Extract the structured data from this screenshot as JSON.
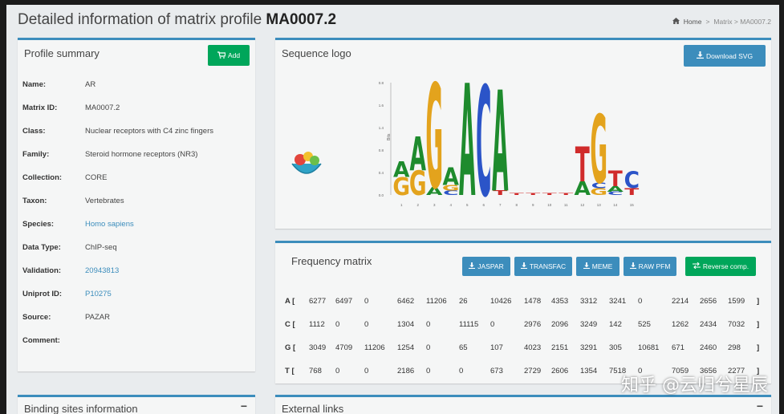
{
  "page": {
    "title_prefix": "Detailed information of matrix profile ",
    "title_id": "MA0007.2"
  },
  "breadcrumb": {
    "home": "Home",
    "sep": ">",
    "matrix": "Matrix > MA0007.2"
  },
  "summary": {
    "title": "Profile summary",
    "add_label": "Add",
    "fields": [
      {
        "k": "Name:",
        "v": "AR",
        "link": false
      },
      {
        "k": "Matrix ID:",
        "v": "MA0007.2",
        "link": false
      },
      {
        "k": "Class:",
        "v": "Nuclear receptors with C4 zinc fingers",
        "link": false
      },
      {
        "k": "Family:",
        "v": "Steroid hormone receptors (NR3)",
        "link": false
      },
      {
        "k": "Collection:",
        "v": "CORE",
        "link": false
      },
      {
        "k": "Taxon:",
        "v": "Vertebrates",
        "link": false
      },
      {
        "k": "Species:",
        "v": "Homo sapiens",
        "link": true
      },
      {
        "k": "Data Type:",
        "v": "ChIP-seq",
        "link": false
      },
      {
        "k": "Validation:",
        "v": "20943813",
        "link": true
      },
      {
        "k": "Uniprot ID:",
        "v": "P10275",
        "link": true
      },
      {
        "k": "Source:",
        "v": "PAZAR",
        "link": false
      },
      {
        "k": "Comment:",
        "v": "",
        "link": false
      }
    ]
  },
  "logo": {
    "title": "Sequence logo",
    "download_label": "Download SVG",
    "ylabel": "Bits",
    "yticks": [
      "0.8",
      "1.6",
      "1.4",
      "0.8",
      "0.4",
      "0.0"
    ],
    "positions": [
      "1",
      "2",
      "3",
      "4",
      "5",
      "6",
      "7",
      "8",
      "9",
      "10",
      "11",
      "12",
      "13",
      "14",
      "15"
    ],
    "stacks": [
      [
        {
          "b": "G",
          "h": 0.16
        },
        {
          "b": "A",
          "h": 0.14
        }
      ],
      [
        {
          "b": "G",
          "h": 0.22
        },
        {
          "b": "A",
          "h": 0.3
        }
      ],
      [
        {
          "b": "A",
          "h": 0.07
        },
        {
          "b": "G",
          "h": 0.93
        }
      ],
      [
        {
          "b": "C",
          "h": 0.04
        },
        {
          "b": "G",
          "h": 0.05
        },
        {
          "b": "A",
          "h": 0.16
        }
      ],
      [
        {
          "b": "A",
          "h": 1.0
        }
      ],
      [
        {
          "b": "C",
          "h": 0.98
        }
      ],
      [
        {
          "b": "T",
          "h": 0.04
        },
        {
          "b": "A",
          "h": 0.9
        }
      ],
      [
        {
          "b": "T",
          "h": 0.02
        }
      ],
      [
        {
          "b": "T",
          "h": 0.02
        }
      ],
      [
        {
          "b": "T",
          "h": 0.02
        }
      ],
      [
        {
          "b": "T",
          "h": 0.02
        }
      ],
      [
        {
          "b": "A",
          "h": 0.12
        },
        {
          "b": "T",
          "h": 0.31
        }
      ],
      [
        {
          "b": "G",
          "h": 0.06
        },
        {
          "b": "C",
          "h": 0.05
        },
        {
          "b": "G",
          "h": 0.61
        }
      ],
      [
        {
          "b": "C",
          "h": 0.03
        },
        {
          "b": "A",
          "h": 0.05
        },
        {
          "b": "T",
          "h": 0.14
        }
      ],
      [
        {
          "b": "T",
          "h": 0.06
        },
        {
          "b": "C",
          "h": 0.15
        }
      ]
    ],
    "colors": {
      "A": "#1e8b2d",
      "C": "#2b54c8",
      "G": "#e3a31d",
      "T": "#d02b2b"
    }
  },
  "matrix": {
    "title": "Frequency matrix",
    "buttons": [
      "JASPAR",
      "TRANSFAC",
      "MEME",
      "RAW PFM"
    ],
    "reverse_label": "Reverse comp.",
    "rows": [
      {
        "base": "A [",
        "values": [
          "6277",
          "6497",
          "0",
          "6462",
          "11206",
          "26",
          "10426",
          "1478",
          "4353",
          "3312",
          "3241",
          "0",
          "2214",
          "2656",
          "1599"
        ],
        "close": "]"
      },
      {
        "base": "C [",
        "values": [
          "1112",
          "0",
          "0",
          "1304",
          "0",
          "11115",
          "0",
          "2976",
          "2096",
          "3249",
          "142",
          "525",
          "1262",
          "2434",
          "7032"
        ],
        "close": "]"
      },
      {
        "base": "G [",
        "values": [
          "3049",
          "4709",
          "11206",
          "1254",
          "0",
          "65",
          "107",
          "4023",
          "2151",
          "3291",
          "305",
          "10681",
          "671",
          "2460",
          "298"
        ],
        "close": "]"
      },
      {
        "base": "T [",
        "values": [
          "768",
          "0",
          "0",
          "2186",
          "0",
          "0",
          "673",
          "2729",
          "2606",
          "1354",
          "7518",
          "0",
          "7059",
          "3656",
          "2277"
        ],
        "close": "]"
      }
    ]
  },
  "binding": {
    "title": "Binding sites information",
    "collapse": "−"
  },
  "links": {
    "title": "External links",
    "collapse": "−"
  },
  "watermark": "知乎 @云归兮星辰"
}
